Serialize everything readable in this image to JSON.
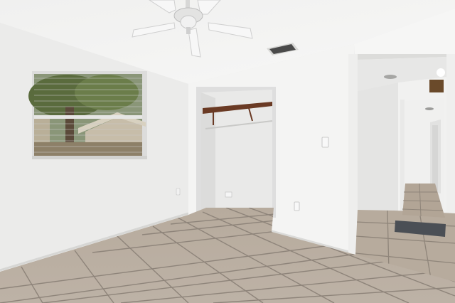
{
  "scene": {
    "colors": {
      "ceiling": "#f2f2f1",
      "wall_left": "#ededec",
      "wall_center": "#f4f4f3",
      "wall_right": "#f6f6f5",
      "floor_tile": "#b9ada0",
      "grout": "#8f857a",
      "closet_shelf": "#6a3a24",
      "window_glass": "#7d8a6c",
      "vent": "#4a4a4a"
    },
    "icons": {
      "ceiling_fan": "ceiling-fan-icon",
      "vent": "air-vent-icon",
      "outlet": "electrical-outlet-icon",
      "light_switch": "light-switch-icon",
      "doormat": "doormat-icon",
      "light_fixture": "ceiling-light-icon"
    }
  }
}
